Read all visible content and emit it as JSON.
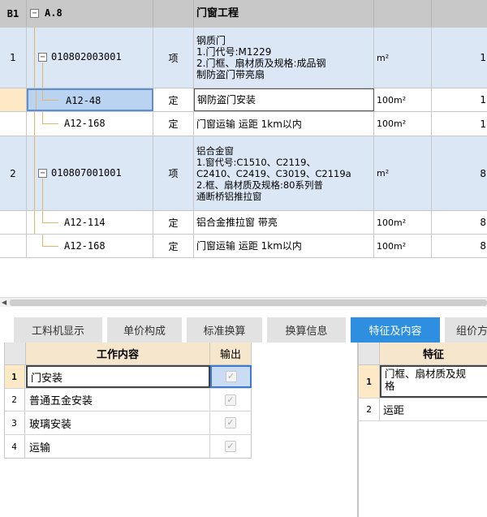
{
  "bill_grid": {
    "header": {
      "no": "B1",
      "code": "A.8",
      "name": "门窗工程"
    },
    "rows": [
      {
        "no": "1",
        "code": "010802003001",
        "type": "项",
        "name_lines": [
          "钢质门",
          "1.门代号:M1229",
          "2.门框、扇材质及规格:成品钢",
          "制防盗门带亮扇"
        ],
        "unit": "m²",
        "qty": "1"
      },
      {
        "no": "",
        "code": "A12-48",
        "type": "定",
        "name_lines": [
          "钢防盗门安装"
        ],
        "unit": "100m²",
        "qty": "1"
      },
      {
        "no": "",
        "code": "A12-168",
        "type": "定",
        "name_lines": [
          "门窗运输 运距 1km以内"
        ],
        "unit": "100m²",
        "qty": "1"
      },
      {
        "no": "2",
        "code": "010807001001",
        "type": "项",
        "name_lines": [
          "铝合金窗",
          "1.窗代号:C1510、C2119、",
          "C2410、C2419、C3019、C2119a",
          "2.框、扇材质及规格:80系列普",
          "通断桥铝推拉窗"
        ],
        "unit": "m²",
        "qty": "8"
      },
      {
        "no": "",
        "code": "A12-114",
        "type": "定",
        "name_lines": [
          "铝合金推拉窗 带亮"
        ],
        "unit": "100m²",
        "qty": "8"
      },
      {
        "no": "",
        "code": "A12-168",
        "type": "定",
        "name_lines": [
          "门窗运输 运距 1km以内"
        ],
        "unit": "100m²",
        "qty": "8"
      }
    ]
  },
  "tabs": [
    "工料机显示",
    "单价构成",
    "标准换算",
    "换算信息",
    "特征及内容",
    "组价方"
  ],
  "active_tab": "特征及内容",
  "work_content": {
    "headers": {
      "content": "工作内容",
      "output": "输出"
    },
    "rows": [
      {
        "idx": "1",
        "text": "门安装",
        "checked": true
      },
      {
        "idx": "2",
        "text": "普通五金安装",
        "checked": true
      },
      {
        "idx": "3",
        "text": "玻璃安装",
        "checked": true
      },
      {
        "idx": "4",
        "text": "运输",
        "checked": true
      }
    ]
  },
  "features": {
    "header": "特征",
    "rows": [
      {
        "idx": "1",
        "lines": [
          "门框、扇材质及规",
          "格"
        ]
      },
      {
        "idx": "2",
        "lines": [
          "运距"
        ]
      }
    ]
  },
  "colors": {
    "bill_row": "#dce7f6",
    "header_row": "#c8c8c8",
    "active_tab": "#2e8ee0",
    "selected_index": "#fde9c5",
    "tree_line": "#e3b46b"
  }
}
